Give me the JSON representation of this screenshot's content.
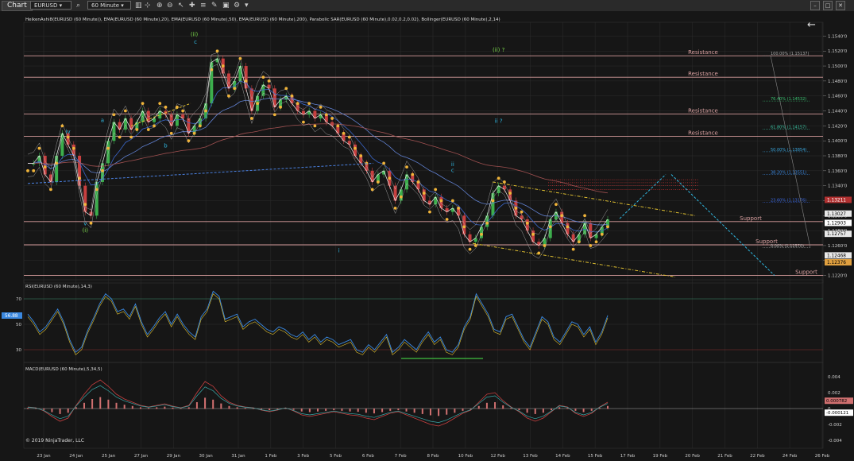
{
  "toolbar": {
    "title": "Chart",
    "instrument": "EURUSD",
    "interval": "60 Minute",
    "icons": [
      "search-icon",
      "bar-style-icon",
      "crosshair-icon",
      "cursor-icon",
      "zoom-icon",
      "list-icon",
      "draw-icon",
      "properties-icon"
    ]
  },
  "window_buttons": {
    "minimize": "–",
    "maximize": "□",
    "close": "✕"
  },
  "indicator_label": "HeikenAshi8(EURUSD (60 Minute)), EMA(EURUSD (60 Minute),20), EMA(EURUSD (60 Minute),50), EMA(EURUSD (60 Minute),200), Parabolic SAR(EURUSD (60 Minute),0.02,0.2,0.02), Bollinger(EURUSD (60 Minute),2,14)",
  "rsi_label": "RSI(EURUSD (60 Minute),14,3)",
  "macd_label": "MACD(EURUSD (60 Minute),5,34,5)",
  "copyright": "© 2019 NinjaTrader, LLC",
  "colors": {
    "bg": "#161616",
    "grid": "#2c2c2c",
    "price": "#eeeeee",
    "level": "#d49a9a",
    "sar": "#f0b43a",
    "ema20": "#3a66c8",
    "ema200": "#a05050",
    "wave": "#2fb7e0",
    "fib_high": "#aaaaaa"
  },
  "chart_data": [
    {
      "type": "line",
      "pane": "price",
      "title": "",
      "x_labels": [
        "23 Jan",
        "24 Jan",
        "25 Jan",
        "27 Jan",
        "29 Jan",
        "30 Jan",
        "31 Jan",
        "1 Feb",
        "3 Feb",
        "5 Feb",
        "6 Feb",
        "7 Feb",
        "8 Feb",
        "10 Feb",
        "12 Feb",
        "13 Feb",
        "14 Feb",
        "15 Feb",
        "17 Feb",
        "19 Feb",
        "20 Feb",
        "21 Feb",
        "22 Feb",
        "24 Feb",
        "26 Feb"
      ],
      "y_ticks": [
        "1.1540'0",
        "1.1520'0",
        "1.1500'0",
        "1.1480'0",
        "1.1460'0",
        "1.1440'0",
        "1.1420'0",
        "1.1400'0",
        "1.1380'0",
        "1.1360'0",
        "1.1340'0",
        "1.1320'0",
        "1.1300'0",
        "1.1280'0",
        "1.1260'0",
        "1.1240'0",
        "1.1220'0"
      ],
      "ylim": [
        1.121,
        1.155
      ],
      "price_boxes": [
        {
          "label": "1.13211",
          "value": 1.13211,
          "bg": "#b03030",
          "fg": "#ffffff"
        },
        {
          "label": "1.13027",
          "value": 1.13027,
          "bg": "#e8e8e8",
          "fg": "#000000"
        },
        {
          "label": "1.12903",
          "value": 1.12903,
          "bg": "#ffffff",
          "fg": "#000000"
        },
        {
          "label": "1.12757",
          "value": 1.12757,
          "bg": "#e8e8e8",
          "fg": "#000000"
        },
        {
          "label": "1.12468",
          "value": 1.12468,
          "bg": "#e8e8e8",
          "fg": "#000000"
        },
        {
          "label": "1.12376",
          "value": 1.12376,
          "bg": "#e0a040",
          "fg": "#000000"
        }
      ],
      "horizontal_levels": [
        {
          "value": 1.15137,
          "label": "Resistance"
        },
        {
          "value": 1.1485,
          "label": "Resistance"
        },
        {
          "value": 1.1436,
          "label": "Resistance"
        },
        {
          "value": 1.1406,
          "label": "Resistance"
        },
        {
          "value": 1.1292,
          "label": "Support"
        },
        {
          "value": 1.1261,
          "label": "Support"
        },
        {
          "value": 1.122,
          "label": "Support"
        }
      ],
      "fib_levels": [
        {
          "label": "100.00% (1.15137)",
          "value": 1.15137,
          "color": "#aaaaaa"
        },
        {
          "label": "76.40% (1.14532)",
          "value": 1.14532,
          "color": "#39c070"
        },
        {
          "label": "61.80% (1.14157)",
          "value": 1.14157,
          "color": "#39c0a0"
        },
        {
          "label": "50.00% (1.13854)",
          "value": 1.13854,
          "color": "#3aa8e0"
        },
        {
          "label": "38.20% (1.13551)",
          "value": 1.13551,
          "color": "#3a88e0"
        },
        {
          "label": "23.60% (1.13176)",
          "value": 1.13176,
          "color": "#3a68e0"
        },
        {
          "label": "0.00% (1.12570)",
          "value": 1.1257,
          "color": "#aaaaaa"
        }
      ],
      "wave_labels": [
        {
          "text": "(ii)",
          "color": "#7ad84a",
          "x": 14.5,
          "y": 1.154
        },
        {
          "text": "c",
          "color": "#2fb7e0",
          "x": 14.6,
          "y": 1.153
        },
        {
          "text": "iv",
          "color": "#2fb7e0",
          "x": 3.5,
          "y": 1.141
        },
        {
          "text": "a",
          "color": "#2fb7e0",
          "x": 6.5,
          "y": 1.1425
        },
        {
          "text": "b",
          "color": "#2fb7e0",
          "x": 12.0,
          "y": 1.1391
        },
        {
          "text": "v",
          "color": "#2fb7e0",
          "x": 5.0,
          "y": 1.1287
        },
        {
          "text": "(i)",
          "color": "#7ad84a",
          "x": 5.0,
          "y": 1.1278
        },
        {
          "text": "i",
          "color": "#2fb7e0",
          "x": 27.1,
          "y": 1.1251
        },
        {
          "text": "ii",
          "color": "#2fb7e0",
          "x": 37.0,
          "y": 1.1366
        },
        {
          "text": "c",
          "color": "#2fb7e0",
          "x": 37.0,
          "y": 1.1358
        },
        {
          "text": "(ii) ?",
          "color": "#7ad84a",
          "x": 41.0,
          "y": 1.1519
        },
        {
          "text": "ii ?",
          "color": "#2fb7e0",
          "x": 41.0,
          "y": 1.1424
        }
      ],
      "close_series": [
        1.137,
        1.137,
        1.138,
        1.1355,
        1.1345,
        1.138,
        1.141,
        1.1395,
        1.138,
        1.134,
        1.1305,
        1.13,
        1.1345,
        1.137,
        1.14,
        1.1425,
        1.1415,
        1.143,
        1.1415,
        1.1425,
        1.144,
        1.1425,
        1.143,
        1.144,
        1.1435,
        1.142,
        1.1435,
        1.143,
        1.141,
        1.142,
        1.143,
        1.145,
        1.1505,
        1.151,
        1.149,
        1.147,
        1.148,
        1.15,
        1.147,
        1.144,
        1.146,
        1.1475,
        1.147,
        1.1445,
        1.1455,
        1.146,
        1.145,
        1.144,
        1.1435,
        1.144,
        1.143,
        1.1435,
        1.1425,
        1.142,
        1.141,
        1.14,
        1.1395,
        1.138,
        1.137,
        1.136,
        1.1345,
        1.1355,
        1.136,
        1.134,
        1.132,
        1.1335,
        1.1355,
        1.1345,
        1.1335,
        1.132,
        1.1315,
        1.1325,
        1.131,
        1.1305,
        1.131,
        1.13,
        1.1275,
        1.1265,
        1.127,
        1.1285,
        1.13,
        1.133,
        1.134,
        1.1335,
        1.132,
        1.13,
        1.1295,
        1.128,
        1.1265,
        1.126,
        1.127,
        1.1295,
        1.1305,
        1.129,
        1.1275,
        1.1265,
        1.1275,
        1.129,
        1.127,
        1.1275,
        1.1285,
        1.1295
      ],
      "rsi": {
        "ylim": [
          20,
          80
        ],
        "ticks": [
          70,
          50,
          30
        ],
        "value_box": "56.88",
        "values": [
          58,
          52,
          44,
          48,
          55,
          62,
          52,
          38,
          28,
          32,
          45,
          55,
          66,
          74,
          70,
          60,
          62,
          56,
          66,
          52,
          42,
          48,
          55,
          60,
          50,
          58,
          50,
          44,
          40,
          56,
          62,
          76,
          72,
          54,
          56,
          58,
          48,
          52,
          54,
          50,
          46,
          44,
          48,
          46,
          42,
          40,
          44,
          38,
          42,
          36,
          40,
          38,
          34,
          36,
          38,
          30,
          28,
          34,
          30,
          36,
          42,
          28,
          32,
          38,
          34,
          30,
          38,
          44,
          36,
          40,
          30,
          28,
          34,
          48,
          56,
          74,
          66,
          58,
          46,
          44,
          56,
          58,
          48,
          38,
          32,
          44,
          56,
          52,
          40,
          36,
          44,
          52,
          50,
          42,
          48,
          36,
          44,
          57
        ]
      },
      "macd": {
        "ylim": [
          -0.005,
          0.005
        ],
        "ticks": [
          "0.004",
          "0.002",
          "0",
          "-0.002",
          "-0.004"
        ],
        "value_boxes": [
          {
            "label": "0.000782",
            "bg": "#d07070"
          },
          {
            "label": "-0.000121",
            "bg": "#ffffff"
          }
        ],
        "values": [
          0.0002,
          0.0001,
          -0.0003,
          -0.001,
          -0.0016,
          -0.0012,
          0.0004,
          0.0018,
          0.003,
          0.0036,
          0.0028,
          0.0018,
          0.0012,
          0.0008,
          0.0004,
          0.0002,
          0.0004,
          0.0006,
          0.0003,
          0.0001,
          0.0004,
          0.002,
          0.0034,
          0.0028,
          0.0016,
          0.0008,
          0.0004,
          0.0002,
          0.0001,
          -0.0002,
          -0.0004,
          -0.0002,
          0.0001,
          -0.0003,
          -0.0008,
          -0.001,
          -0.0008,
          -0.0006,
          -0.0004,
          -0.0006,
          -0.0008,
          -0.0009,
          -0.0012,
          -0.0014,
          -0.001,
          -0.0006,
          -0.0004,
          -0.0008,
          -0.0012,
          -0.0016,
          -0.002,
          -0.0022,
          -0.0018,
          -0.0012,
          -0.0006,
          -0.0002,
          0.0008,
          0.0018,
          0.002,
          0.001,
          0.0002,
          -0.0004,
          -0.0012,
          -0.0016,
          -0.0012,
          -0.0004,
          0.0004,
          0.0002,
          -0.0006,
          -0.001,
          -0.0006,
          0.0002,
          0.0008
        ]
      }
    }
  ]
}
